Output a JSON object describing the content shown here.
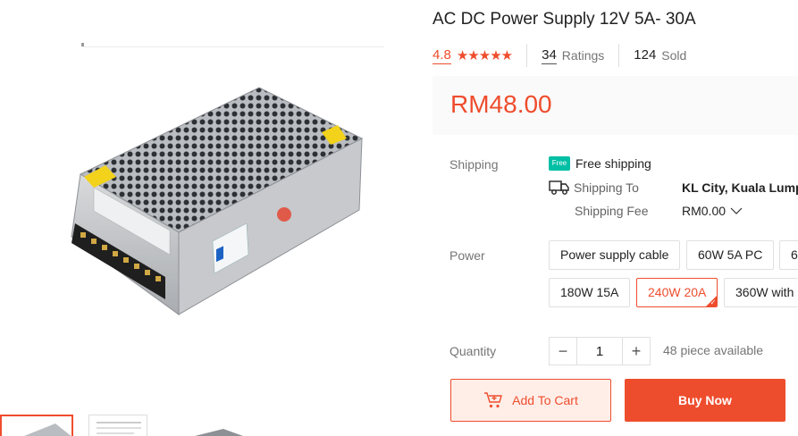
{
  "product": {
    "title": "AC DC Power Supply 12V 5A- 30A",
    "rating": "4.8",
    "stars": "★★★★★",
    "ratings_count": "34",
    "ratings_label": "Ratings",
    "sold_count": "124",
    "sold_label": "Sold",
    "price": "RM48.00"
  },
  "shipping": {
    "label": "Shipping",
    "free_badge": "Free",
    "free_text": "Free shipping",
    "to_label": "Shipping To",
    "to_value": "KL City, Kuala Lumpur",
    "fee_label": "Shipping Fee",
    "fee_value": "RM0.00",
    "fee_chevron": "chevron-down-icon"
  },
  "variations": {
    "label": "Power",
    "options": [
      "Power supply cable",
      "60W 5A PC",
      "6",
      "180W 15A",
      "240W 20A",
      "360W with"
    ],
    "selected": "240W 20A"
  },
  "quantity": {
    "label": "Quantity",
    "value": "1",
    "minus": "−",
    "plus": "+",
    "available": "48 piece available"
  },
  "actions": {
    "add_to_cart": "Add To Cart",
    "buy_now": "Buy Now"
  },
  "colors": {
    "accent": "#ee4d2d",
    "free_badge": "#00bfa5"
  }
}
